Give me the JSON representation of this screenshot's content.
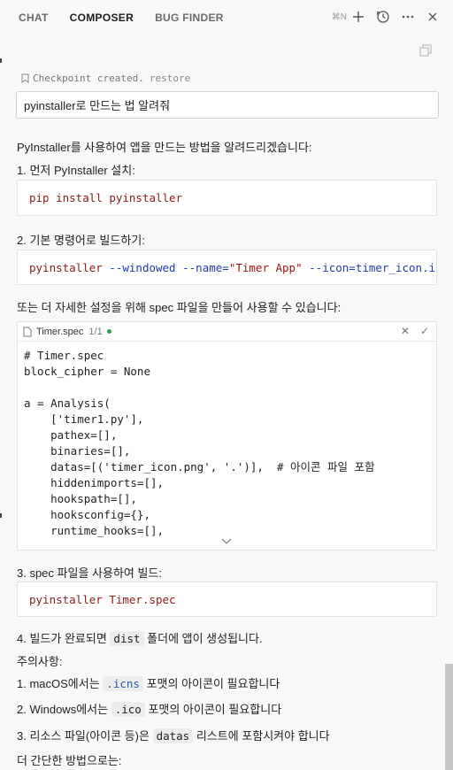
{
  "tabs": [
    {
      "label": "CHAT"
    },
    {
      "label": "COMPOSER"
    },
    {
      "label": "BUG FINDER"
    }
  ],
  "toolbar": {
    "shortcut": "⌘N"
  },
  "checkpoint": {
    "text": "Checkpoint created.",
    "restore": "restore"
  },
  "query": "pyinstaller로 만드는 법 알려줘",
  "response": {
    "intro": "PyInstaller를 사용하여 앱을 만드는 방법을 알려드리겠습니다:",
    "step1": "1. 먼저 PyInstaller 설치:",
    "code1": {
      "cmd": "pip",
      "rest": "install pyinstaller"
    },
    "step2": "2. 기본 명령어로 빌드하기:",
    "code2": {
      "cmd": "pyinstaller",
      "f1": "--windowed",
      "f2": "--name=",
      "name_val": "\"Timer App\"",
      "f3": "--icon=timer_icon.ic"
    },
    "spec_intro": "또는 더 자세한 설정을 위해 spec 파일을 만들어 사용할 수 있습니다:",
    "editor": {
      "filename": "Timer.spec",
      "count": "1/1",
      "lines": "# Timer.spec\nblock_cipher = None\n\na = Analysis(\n    ['timer1.py'],\n    pathex=[],\n    binaries=[],\n    datas=[('timer_icon.png', '.')],  # 아이콘 파일 포함\n    hiddenimports=[],\n    hookspath=[],\n    hooksconfig={},\n    runtime_hooks=[],"
    },
    "step3": "3. spec 파일을 사용하여 빌드:",
    "code3": {
      "cmd": "pyinstaller",
      "arg": "Timer.spec"
    },
    "step4": {
      "pre": "4. 빌드가 완료되면",
      "code": "dist",
      "post": "폴더에 앱이 생성됩니다."
    },
    "notes_title": "주의사항:",
    "note1": {
      "pre": "1. macOS에서는",
      "code": ".icns",
      "post": "포맷의 아이콘이 필요합니다"
    },
    "note2": {
      "pre": "2. Windows에서는",
      "code": ".ico",
      "post": "포맷의 아이콘이 필요합니다"
    },
    "note3": {
      "pre": "3. 리소스 파일(아이콘 등)은",
      "code": "datas",
      "post": "리스트에 포함시켜야 합니다"
    },
    "closing": "더 간단한 방법으로는:"
  }
}
